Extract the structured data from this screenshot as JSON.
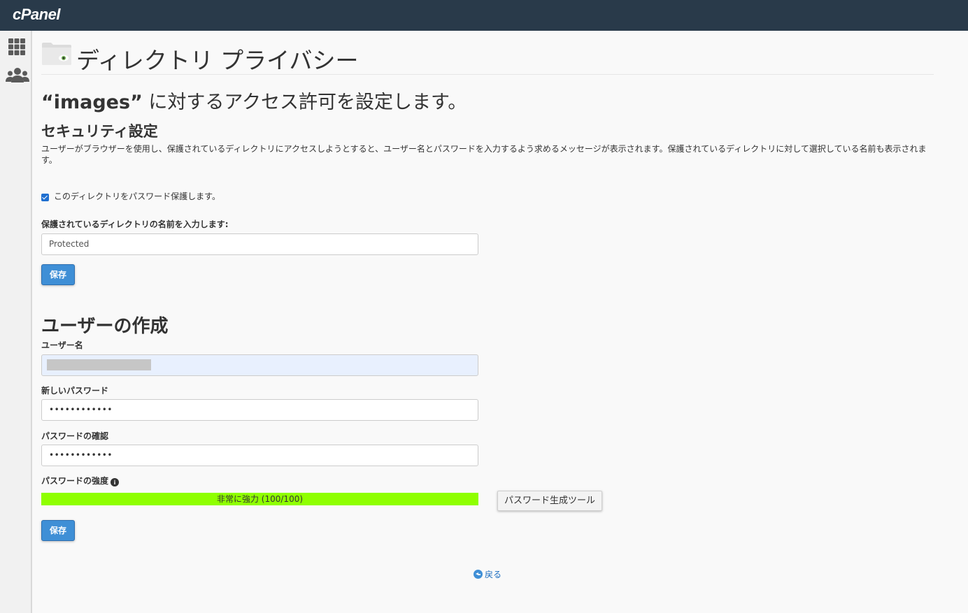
{
  "header": {
    "logo": "cPanel"
  },
  "sidebar": {
    "items": [
      {
        "icon": "apps-grid-icon"
      },
      {
        "icon": "users-icon"
      }
    ]
  },
  "page": {
    "title": "ディレクトリ プライバシー",
    "access_dir": "“images”",
    "access_suffix": " に対するアクセス許可を設定します。"
  },
  "security": {
    "title": "セキュリティ設定",
    "description": "ユーザーがブラウザーを使用し、保護されているディレクトリにアクセスしようとすると、ユーザー名とパスワードを入力するよう求めるメッセージが表示されます。保護されているディレクトリに対して選択している名前も表示されます。",
    "checkbox_label": "このディレクトリをパスワード保護します。",
    "checkbox_checked": true,
    "name_label": "保護されているディレクトリの名前を入力します:",
    "name_value": "Protected",
    "save_label": "保存"
  },
  "create_user": {
    "title": "ユーザーの作成",
    "username_label": "ユーザー名",
    "username_value": "",
    "new_password_label": "新しいパスワード",
    "new_password_value": "••••••••••••",
    "confirm_password_label": "パスワードの確認",
    "confirm_password_value": "••••••••••••",
    "strength_label": "パスワードの強度",
    "strength_text": "非常に強力 (100/100)",
    "strength_value": 100,
    "strength_color": "#8fff00",
    "generator_label": "パスワード生成ツール",
    "save_label": "保存"
  },
  "footer": {
    "back_label": "戻る"
  },
  "colors": {
    "topbar": "#293a4a",
    "primary_button": "#3f8fd6",
    "link": "#1c6dbf"
  }
}
